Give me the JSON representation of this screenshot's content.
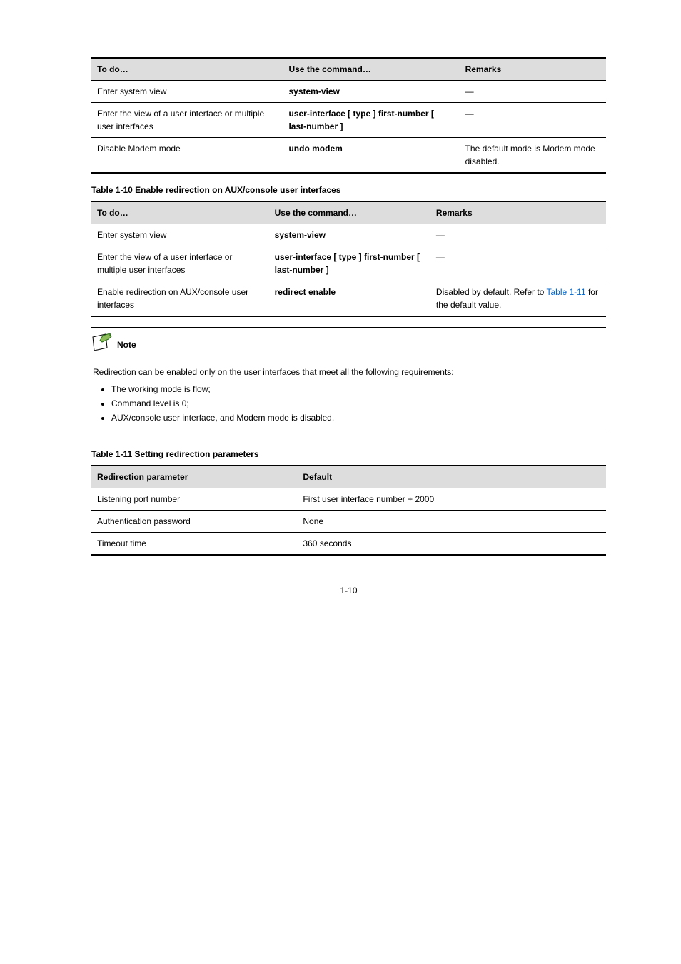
{
  "table9": {
    "headers": [
      "To do…",
      "Use the command…",
      "Remarks"
    ],
    "rows": [
      {
        "c0": "Enter system view",
        "c1": "system-view",
        "c2": "—"
      },
      {
        "c0": "Enter the view of a user interface or multiple user interfaces",
        "c1": "user-interface [ type ] first-number [ last-number ]",
        "c2": "—"
      },
      {
        "c0": "Disable Modem mode",
        "c1": "undo modem",
        "c2": "The default mode is Modem mode disabled."
      }
    ]
  },
  "table10": {
    "title": "Table 1-10 Enable redirection on AUX/console user interfaces",
    "headers": [
      "To do…",
      "Use the command…",
      "Remarks"
    ],
    "rows": [
      {
        "c0": "Enter system view",
        "c1": "system-view",
        "c2": "—"
      },
      {
        "c0": "Enter the view of a user interface or multiple user interfaces",
        "c1": "user-interface [ type ] first-number [ last-number ]",
        "c2": "—"
      },
      {
        "c0": "Enable redirection on AUX/console user interfaces",
        "c1": "redirect enable",
        "c2_pre": "Disabled by default. Refer to ",
        "c2_link1": "Table 1-11",
        "c2_mid": " for the default value."
      }
    ]
  },
  "note": {
    "label": "Note",
    "intro": "Redirection can be enabled only on the user interfaces that meet all the following requirements:",
    "items": [
      "The working mode is flow;",
      "Command level is 0;",
      "AUX/console user interface, and Modem mode is disabled."
    ]
  },
  "table11": {
    "title": "Table 1-11 Setting redirection parameters",
    "headers": [
      "Redirection parameter",
      "Default"
    ],
    "rows": [
      {
        "c0": "Listening port number",
        "c1": "First user interface number + 2000"
      },
      {
        "c0": "Authentication password",
        "c1": "None"
      },
      {
        "c0": "Timeout time",
        "c1": "360 seconds"
      }
    ]
  },
  "pageNum": "1-10"
}
